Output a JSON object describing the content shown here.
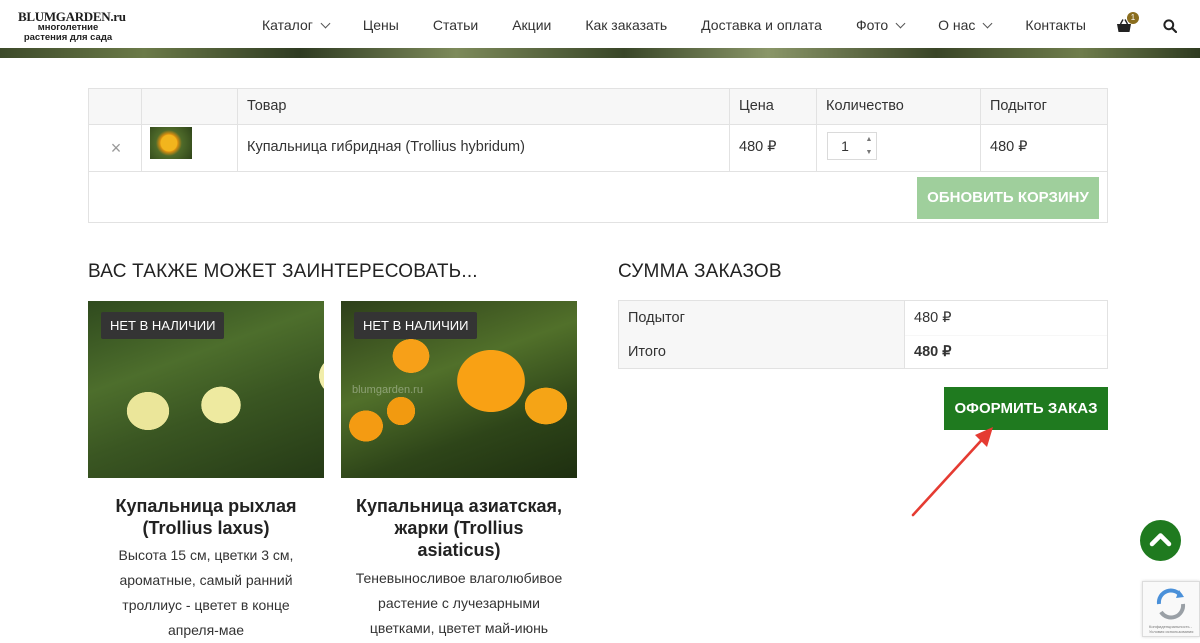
{
  "logo": {
    "brand": "BLUMGARDEN",
    "tld": ".ru",
    "tagline": "многолетние растения для сада"
  },
  "nav": {
    "items": [
      {
        "label": "Каталог",
        "has_dropdown": true
      },
      {
        "label": "Цены",
        "has_dropdown": false
      },
      {
        "label": "Статьи",
        "has_dropdown": false
      },
      {
        "label": "Акции",
        "has_dropdown": false
      },
      {
        "label": "Как заказать",
        "has_dropdown": false
      },
      {
        "label": "Доставка и оплата",
        "has_dropdown": false
      },
      {
        "label": "Фото",
        "has_dropdown": true
      },
      {
        "label": "О нас",
        "has_dropdown": true
      },
      {
        "label": "Контакты",
        "has_dropdown": false
      }
    ],
    "cart_count": "1"
  },
  "cart": {
    "headers": {
      "product": "Товар",
      "price": "Цена",
      "quantity": "Количество",
      "subtotal": "Подытог"
    },
    "rows": [
      {
        "product": "Купальница гибридная (Trollius hybridum)",
        "price": "480 ₽",
        "quantity": "1",
        "subtotal": "480 ₽"
      }
    ],
    "update_button": "ОБНОВИТЬ КОРЗИНУ"
  },
  "related": {
    "title": "ВАС ТАКЖЕ МОЖЕТ ЗАИНТЕРЕСОВАТЬ...",
    "watermark": "blumgarden.ru",
    "products": [
      {
        "badge": "НЕТ В НАЛИЧИИ",
        "title_lines": [
          "Купальница рыхлая",
          "(Trollius laxus)"
        ],
        "desc_lines": [
          "Высота 15 см, цветки 3 см,",
          "ароматные, самый ранний",
          "троллиус - цветет в конце",
          "апреля-мае"
        ]
      },
      {
        "badge": "НЕТ В НАЛИЧИИ",
        "title_lines": [
          "Купальница азиатская,",
          "жарки (Trollius",
          "asiaticus)"
        ],
        "desc_lines": [
          "Теневыносливое влаголюбивое",
          "растение с лучезарными",
          "цветками, цветет май-июнь"
        ]
      }
    ]
  },
  "totals": {
    "title": "СУММА ЗАКАЗОВ",
    "subtotal_label": "Подытог",
    "subtotal_value": "480 ₽",
    "total_label": "Итого",
    "total_value": "480 ₽",
    "checkout_button": "ОФОРМИТЬ ЗАКАЗ"
  },
  "recaptcha": {
    "text": "Конфиденциальность - Условия использования"
  },
  "colors": {
    "accent_green": "#1f7a1f",
    "update_button": "#9fcf9c",
    "badge_bg": "#343434",
    "arrow": "#e53b32"
  }
}
